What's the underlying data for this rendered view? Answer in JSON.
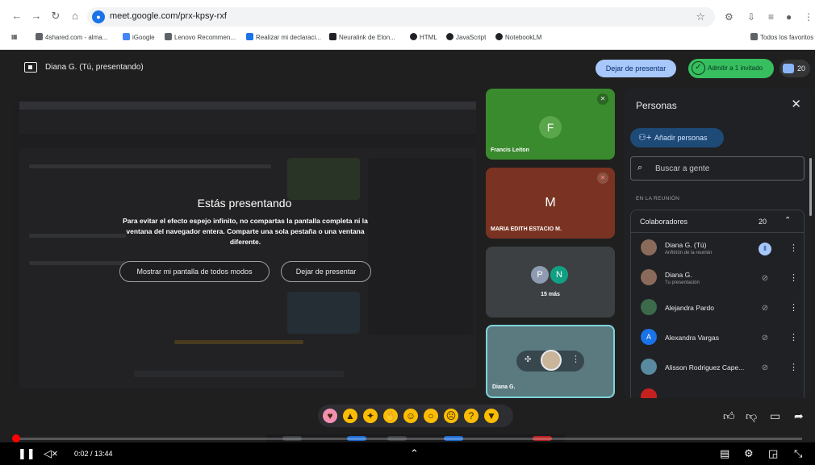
{
  "browser": {
    "url": "meet.google.com/prx-kpsy-rxf",
    "bookmarks": [
      "4shared.com - alma...",
      "iGoogle",
      "Lenovo Recommen...",
      "Realizar mi declaraci...",
      "Neuralink de Elon...",
      "HTML",
      "JavaScript",
      "NotebookLM"
    ],
    "all_bookmarks": "Todos los favoritos"
  },
  "meet_bar": {
    "presenter_title": "Diana G. (Tú, presentando)",
    "stop_presenting": "Dejar de presentar",
    "admit": "Admitir a 1 invitado",
    "participant_count": "20"
  },
  "presentation": {
    "heading": "Estás presentando",
    "body": "Para evitar el efecto espejo infinito, no compartas la pantalla completa ni la ventana del navegador entera. Comparte una sola pestaña o una ventana diferente.",
    "show_anyway": "Mostrar mi pantalla de todos modos",
    "stop": "Dejar de presentar"
  },
  "tiles": [
    {
      "initial": "F",
      "name": "Francis Leiton",
      "color": "#3a8a2e"
    },
    {
      "initial": "M",
      "name": "MARIA EDITH ESTACIO M.",
      "color": "#7a3322"
    },
    {
      "initials": [
        "P",
        "N"
      ],
      "more": "15 más"
    },
    {
      "name": "Diana G."
    }
  ],
  "people": {
    "title": "Personas",
    "add": "Añadir personas",
    "search_placeholder": "Buscar a gente",
    "section": "EN LA REUNIÓN",
    "group": "Colaboradores",
    "group_count": "20",
    "participants": [
      {
        "name": "Diana G. (Tú)",
        "sub": "Anfitrión de la reunión"
      },
      {
        "name": "Diana G.",
        "sub": "Tu presentación"
      },
      {
        "name": "Alejandra Pardo"
      },
      {
        "initial": "A",
        "name": "Alexandra Vargas"
      },
      {
        "name": "Alisson Rodriguez Cape..."
      }
    ]
  },
  "player": {
    "time": "0:02 / 13:44",
    "progress_fraction": 0.003
  }
}
